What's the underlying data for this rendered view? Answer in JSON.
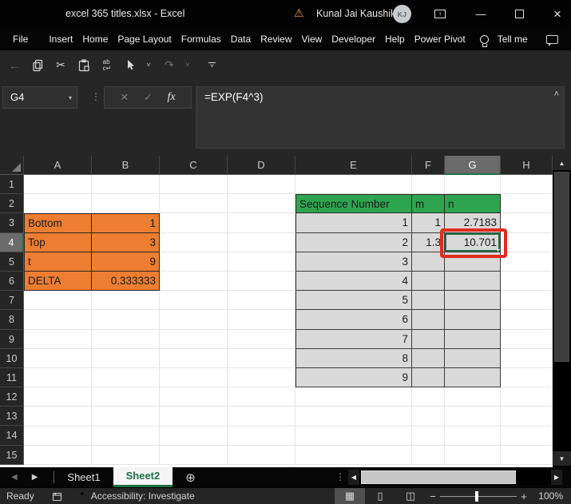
{
  "colors": {
    "accent_green": "#1E7145",
    "table_green": "#2EA44F",
    "table_orange": "#ED7D31",
    "table_gray": "#D9D9D9",
    "annotation_red": "#E02B20"
  },
  "title_bar": {
    "title": "excel 365 titles.xlsx  -  Excel",
    "warning_icon": "⚠",
    "user_name": "Kunal Jai Kaushik",
    "avatar_initials": "KJ",
    "minimize_glyph": "—",
    "close_glyph": "×"
  },
  "menu_bar": {
    "items": [
      "File",
      "Insert",
      "Home",
      "Page Layout",
      "Formulas",
      "Data",
      "Review",
      "View",
      "Developer",
      "Help",
      "Power Pivot"
    ],
    "tell_me": "Tell me"
  },
  "quick_access": {
    "icons": [
      {
        "name": "undo-icon",
        "glyph": "←",
        "enabled": false
      },
      {
        "name": "copy-icon",
        "glyph": "svg-copy",
        "enabled": true
      },
      {
        "name": "cut-icon",
        "glyph": "✂",
        "enabled": true
      },
      {
        "name": "paste-icon",
        "glyph": "svg-paste",
        "enabled": true
      },
      {
        "name": "replace-icon",
        "glyph": "ab\nc↵",
        "enabled": true
      },
      {
        "name": "touch-mode-icon",
        "glyph": "svg-cursor",
        "enabled": true
      },
      {
        "name": "touch-mode-dropdown-icon",
        "glyph": "˅",
        "enabled": true
      },
      {
        "name": "redo-icon",
        "glyph": "↷",
        "enabled": false
      },
      {
        "name": "redo-dropdown-icon",
        "glyph": "˅",
        "enabled": false
      },
      {
        "name": "customize-toolbar-icon",
        "glyph": "─˅",
        "enabled": true
      }
    ]
  },
  "formula_bar": {
    "name_box": "G4",
    "name_box_dropdown": "▾",
    "cancel_glyph": "✕",
    "enter_glyph": "✓",
    "fx_label": "fx",
    "formula": "=EXP(F4^3)",
    "collapse_glyph": "˄"
  },
  "grid": {
    "columns": [
      "A",
      "B",
      "C",
      "D",
      "E",
      "F",
      "G",
      "H"
    ],
    "row_count": 15,
    "selected_cell": "G4",
    "selected_column": "G",
    "selected_row": 4,
    "cells": [
      {
        "c": "A",
        "r": 3,
        "v": "Bottom",
        "bg": "orange",
        "al": "l"
      },
      {
        "c": "B",
        "r": 3,
        "v": "1",
        "bg": "orange",
        "al": "r"
      },
      {
        "c": "A",
        "r": 4,
        "v": "Top",
        "bg": "orange",
        "al": "l"
      },
      {
        "c": "B",
        "r": 4,
        "v": "3",
        "bg": "orange",
        "al": "r"
      },
      {
        "c": "A",
        "r": 5,
        "v": "t",
        "bg": "orange",
        "al": "l"
      },
      {
        "c": "B",
        "r": 5,
        "v": "9",
        "bg": "orange",
        "al": "r"
      },
      {
        "c": "A",
        "r": 6,
        "v": "DELTA",
        "bg": "orange",
        "al": "l"
      },
      {
        "c": "B",
        "r": 6,
        "v": "0.333333",
        "bg": "orange",
        "al": "r"
      },
      {
        "c": "E",
        "r": 2,
        "v": "Sequence Number",
        "bg": "green",
        "al": "l"
      },
      {
        "c": "F",
        "r": 2,
        "v": "m",
        "bg": "green",
        "al": "l"
      },
      {
        "c": "G",
        "r": 2,
        "v": "n",
        "bg": "green",
        "al": "l"
      },
      {
        "c": "E",
        "r": 3,
        "v": "1",
        "bg": "gray",
        "al": "r"
      },
      {
        "c": "E",
        "r": 4,
        "v": "2",
        "bg": "gray",
        "al": "r"
      },
      {
        "c": "E",
        "r": 5,
        "v": "3",
        "bg": "gray",
        "al": "r"
      },
      {
        "c": "E",
        "r": 6,
        "v": "4",
        "bg": "gray",
        "al": "r"
      },
      {
        "c": "E",
        "r": 7,
        "v": "5",
        "bg": "gray",
        "al": "r"
      },
      {
        "c": "E",
        "r": 8,
        "v": "6",
        "bg": "gray",
        "al": "r"
      },
      {
        "c": "E",
        "r": 9,
        "v": "7",
        "bg": "gray",
        "al": "r"
      },
      {
        "c": "E",
        "r": 10,
        "v": "8",
        "bg": "gray",
        "al": "r"
      },
      {
        "c": "E",
        "r": 11,
        "v": "9",
        "bg": "gray",
        "al": "r"
      },
      {
        "c": "F",
        "r": 3,
        "v": "1",
        "bg": "gray",
        "al": "r"
      },
      {
        "c": "F",
        "r": 4,
        "v": "1.3",
        "bg": "gray",
        "al": "r"
      },
      {
        "c": "F",
        "r": 5,
        "v": "",
        "bg": "gray",
        "al": "r"
      },
      {
        "c": "F",
        "r": 6,
        "v": "",
        "bg": "gray",
        "al": "r"
      },
      {
        "c": "F",
        "r": 7,
        "v": "",
        "bg": "gray",
        "al": "r"
      },
      {
        "c": "F",
        "r": 8,
        "v": "",
        "bg": "gray",
        "al": "r"
      },
      {
        "c": "F",
        "r": 9,
        "v": "",
        "bg": "gray",
        "al": "r"
      },
      {
        "c": "F",
        "r": 10,
        "v": "",
        "bg": "gray",
        "al": "r"
      },
      {
        "c": "F",
        "r": 11,
        "v": "",
        "bg": "gray",
        "al": "r"
      },
      {
        "c": "G",
        "r": 3,
        "v": "2.7183",
        "bg": "gray",
        "al": "r"
      },
      {
        "c": "G",
        "r": 4,
        "v": "10.701",
        "bg": "gray",
        "al": "r"
      },
      {
        "c": "G",
        "r": 5,
        "v": "",
        "bg": "gray",
        "al": "r"
      },
      {
        "c": "G",
        "r": 6,
        "v": "",
        "bg": "gray",
        "al": "r"
      },
      {
        "c": "G",
        "r": 7,
        "v": "",
        "bg": "gray",
        "al": "r"
      },
      {
        "c": "G",
        "r": 8,
        "v": "",
        "bg": "gray",
        "al": "r"
      },
      {
        "c": "G",
        "r": 9,
        "v": "",
        "bg": "gray",
        "al": "r"
      },
      {
        "c": "G",
        "r": 10,
        "v": "",
        "bg": "gray",
        "al": "r"
      },
      {
        "c": "G",
        "r": 11,
        "v": "",
        "bg": "gray",
        "al": "r"
      }
    ]
  },
  "sheet_tabs": {
    "tabs": [
      {
        "label": "Sheet1",
        "active": false
      },
      {
        "label": "Sheet2",
        "active": true
      }
    ],
    "add_sheet_glyph": "⊕"
  },
  "status_bar": {
    "mode": "Ready",
    "accessibility": "Accessibility: Investigate",
    "zoom_minus": "−",
    "zoom_plus": "+",
    "zoom_level": "100%"
  }
}
